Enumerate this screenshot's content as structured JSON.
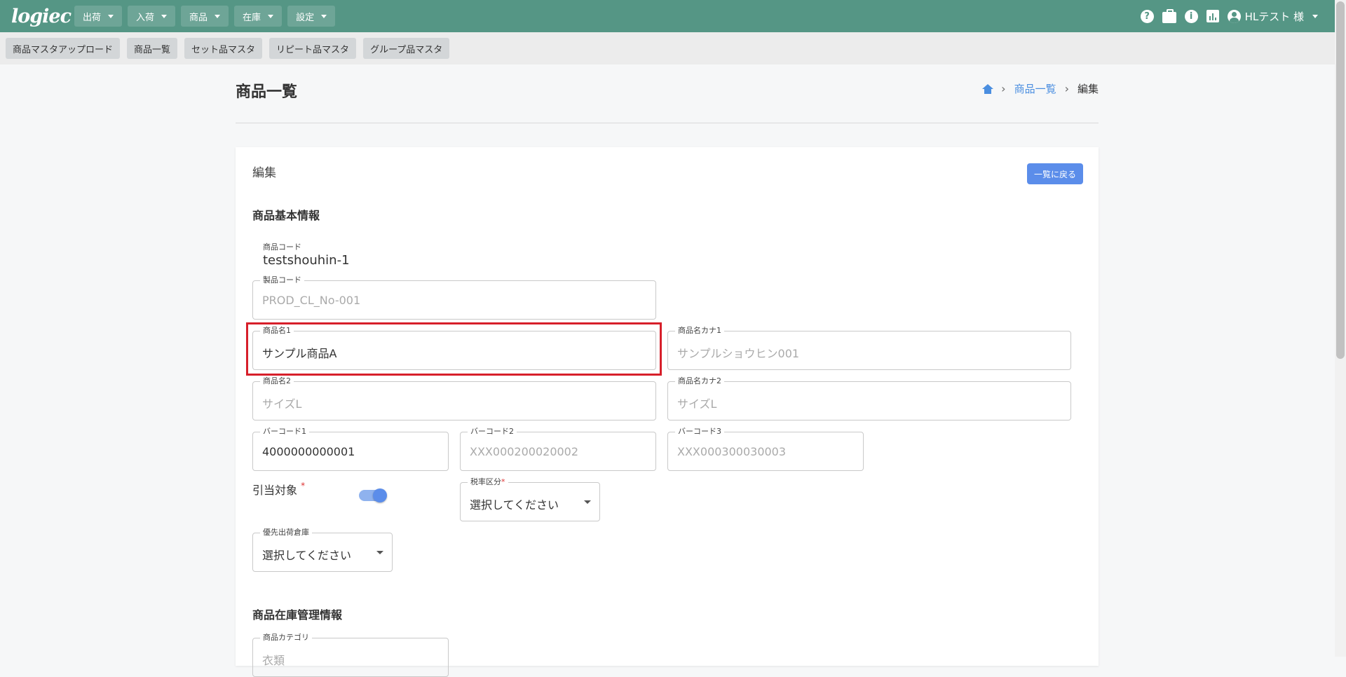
{
  "app": {
    "logo": "logiec"
  },
  "topnav": [
    "出荷",
    "入荷",
    "商品",
    "在庫",
    "設定"
  ],
  "user": {
    "name": "HLテスト 様"
  },
  "subnav": [
    "商品マスタアップロード",
    "商品一覧",
    "セット品マスタ",
    "リピート品マスタ",
    "グループ品マスタ"
  ],
  "page": {
    "title": "商品一覧",
    "breadcrumb": {
      "link": "商品一覧",
      "current": "編集"
    }
  },
  "card": {
    "title": "編集",
    "back_label": "一覧に戻る",
    "section_basic": "商品基本情報",
    "section_stock": "商品在庫管理情報"
  },
  "fields": {
    "product_code_label": "商品コード",
    "product_code_value": "testshouhin-1",
    "manufacturer_code_label": "製品コード",
    "manufacturer_code_placeholder": "PROD_CL_No-001",
    "name1_label": "商品名1",
    "name1_value": "サンプル商品A",
    "kana1_label": "商品名カナ1",
    "kana1_placeholder": "サンプルショウヒン001",
    "name2_label": "商品名2",
    "name2_placeholder": "サイズL",
    "kana2_label": "商品名カナ2",
    "kana2_placeholder": "サイズL",
    "barcode1_label": "バーコード1",
    "barcode1_value": "4000000000001",
    "barcode2_label": "バーコード2",
    "barcode2_placeholder": "XXX000200020002",
    "barcode3_label": "バーコード3",
    "barcode3_placeholder": "XXX000300030003",
    "allocation_label": "引当対象",
    "allocation_on": true,
    "tax_label": "税率区分",
    "tax_value": "選択してください",
    "warehouse_label": "優先出荷倉庫",
    "warehouse_value": "選択してください",
    "category_label": "商品カテゴリ",
    "category_placeholder": "衣類"
  },
  "required_mark": "*",
  "colors": {
    "header": "#559685",
    "accent": "#5b8dea",
    "highlight": "#d71f2a"
  }
}
